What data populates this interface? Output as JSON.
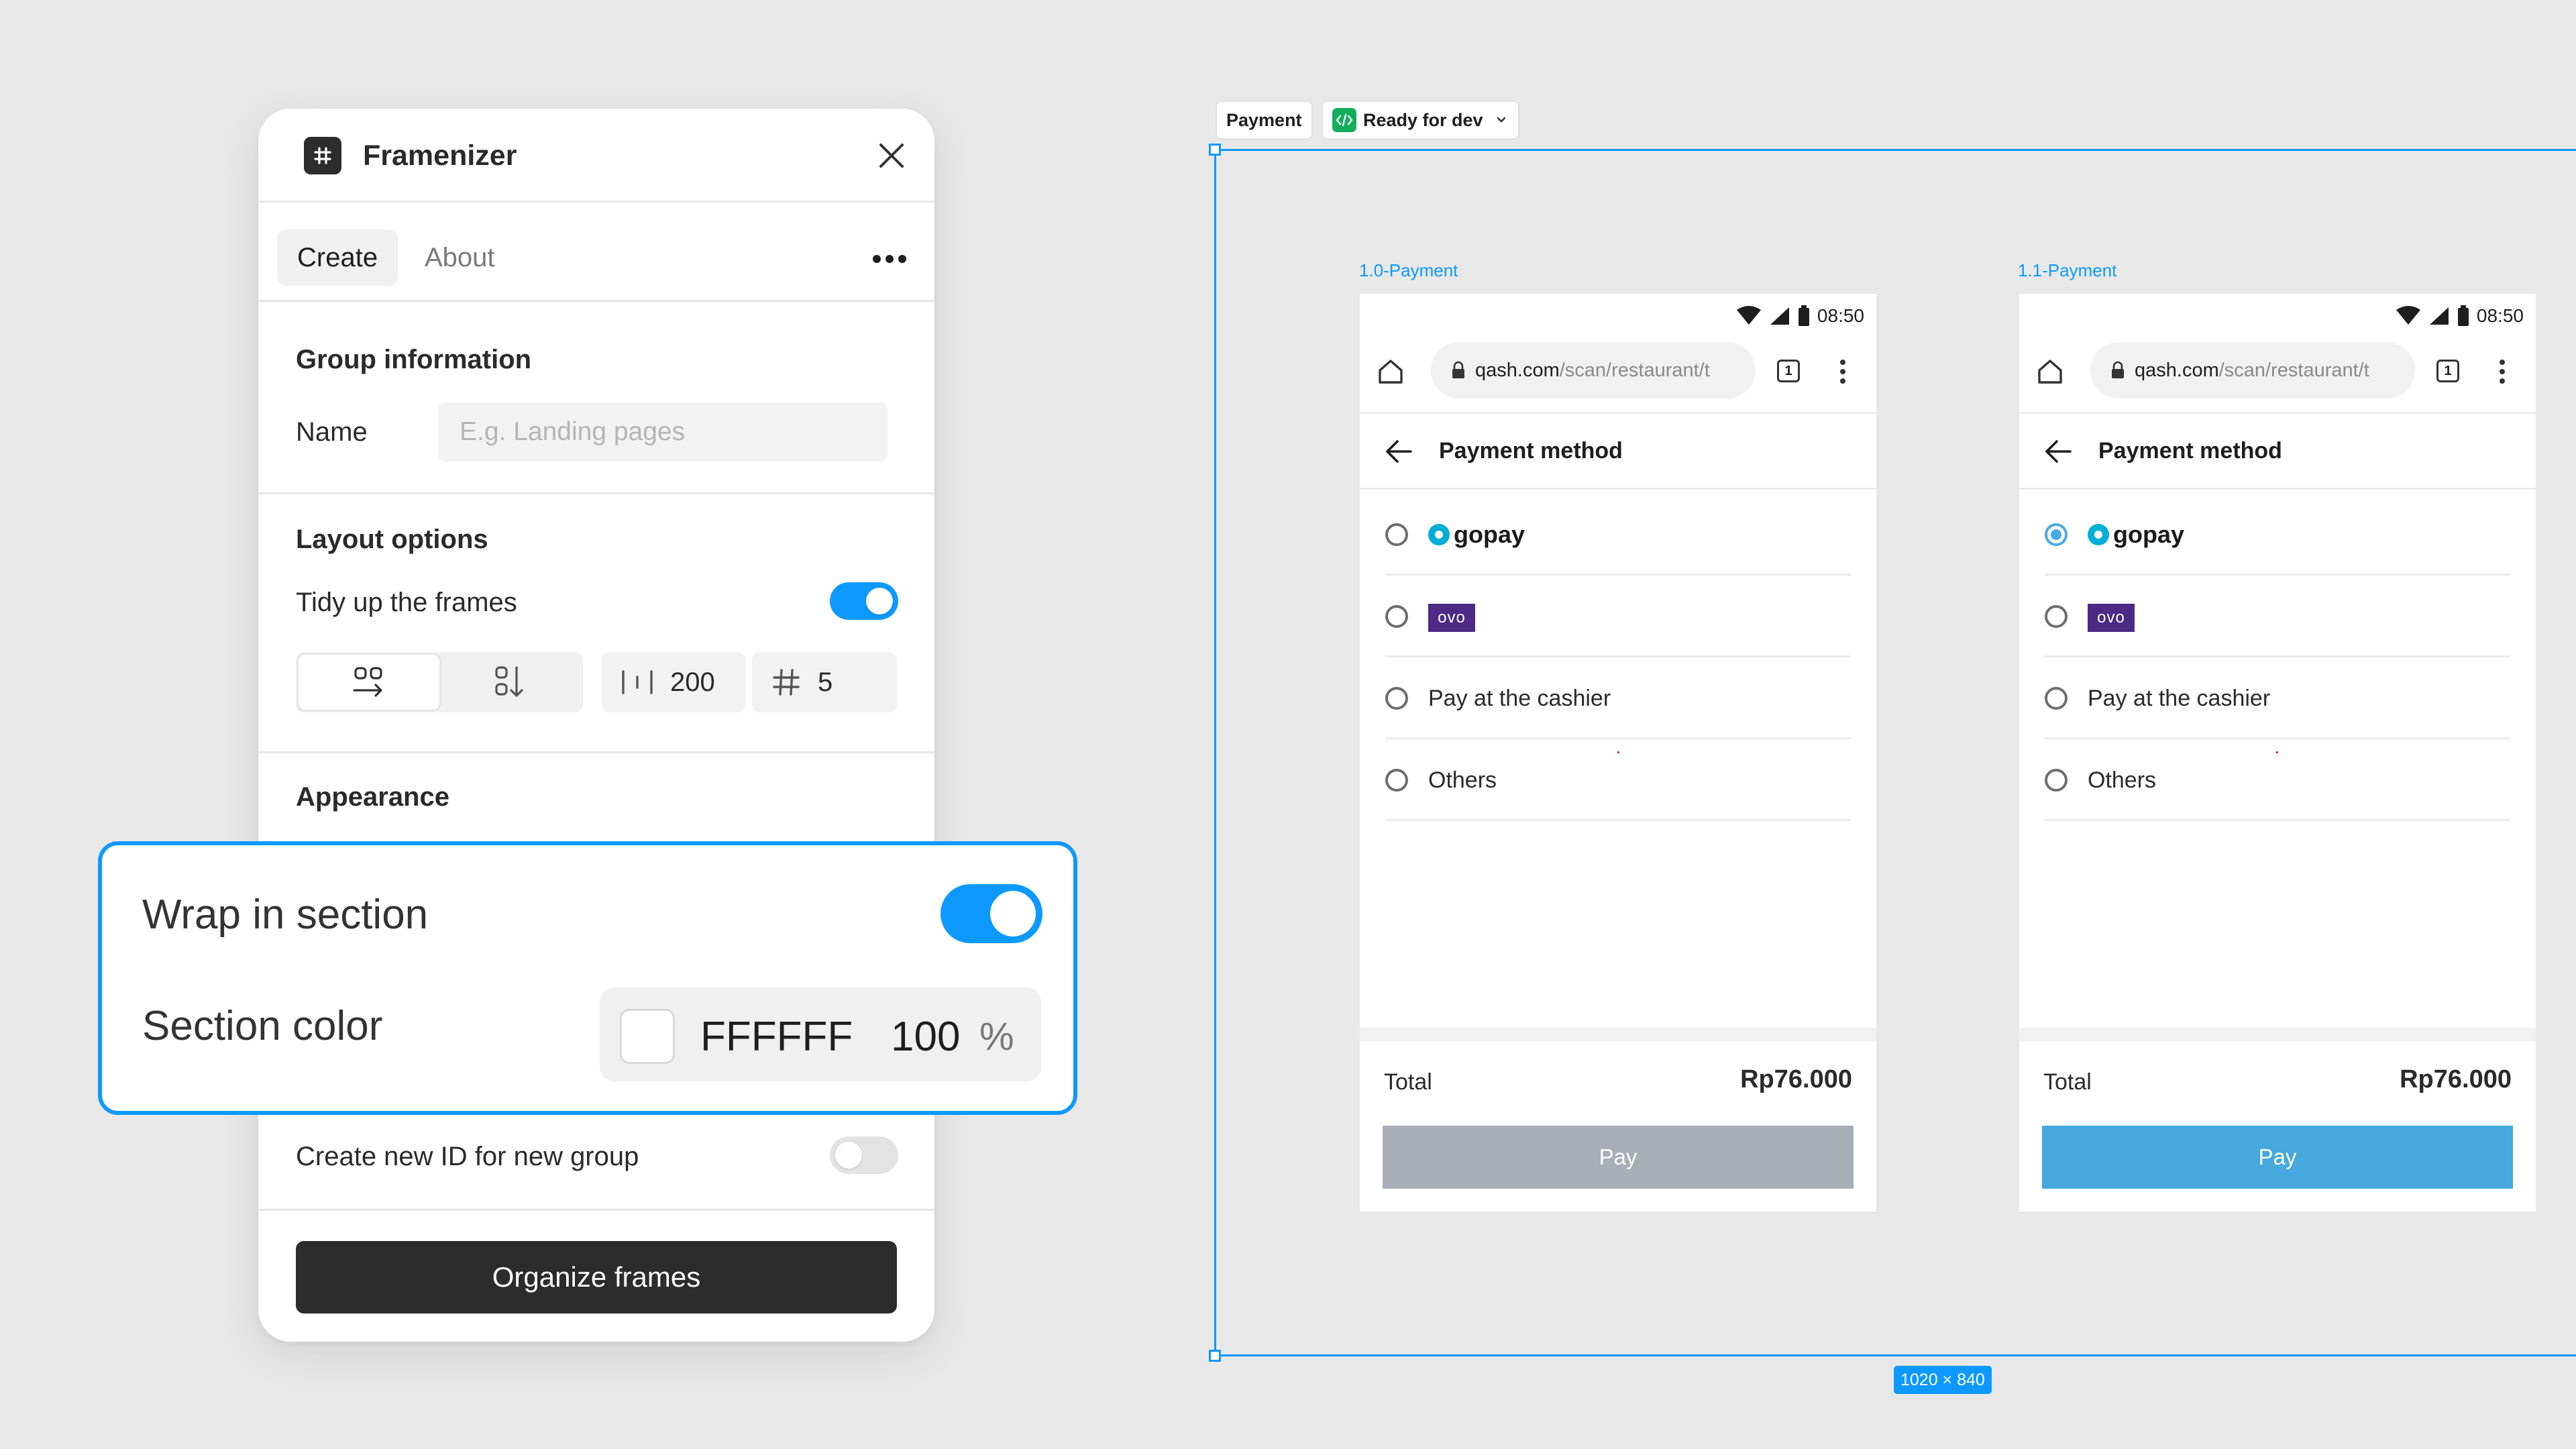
{
  "plugin": {
    "title": "Framenizer",
    "tabs": [
      {
        "label": "Create"
      },
      {
        "label": "About"
      }
    ],
    "group_information": {
      "title": "Group information",
      "name_label": "Name",
      "name_placeholder": "E.g. Landing pages",
      "name_value": ""
    },
    "layout_options": {
      "title": "Layout options",
      "tidy_label": "Tidy up the frames",
      "tidy_on": true,
      "spacing_value": "200",
      "columns_value": "5"
    },
    "appearance": {
      "title": "Appearance"
    },
    "new_id_label": "Create new ID for new group",
    "new_id_on": false,
    "organize_label": "Organize frames"
  },
  "zoom": {
    "wrap_label": "Wrap in section",
    "wrap_on": true,
    "color_label": "Section color",
    "color_hex": "FFFFFF",
    "opacity": "100",
    "opacity_unit": "%"
  },
  "canvas": {
    "section_name": "Payment",
    "status_label": "Ready for dev",
    "dimensions": "1020 × 840",
    "frames": [
      {
        "label": "1.0-Payment",
        "time": "08:50",
        "url_main": "qash.com",
        "url_rest": "/scan/restaurant/t",
        "tab_count": "1",
        "page_title": "Payment method",
        "options": {
          "gopay": "gopay",
          "ovo": "ovo",
          "cashier": "Pay at the cashier",
          "others": "Others"
        },
        "total_label": "Total",
        "total_value": "Rp76.000",
        "pay_label": "Pay"
      },
      {
        "label": "1.1-Payment",
        "time": "08:50",
        "url_main": "qash.com",
        "url_rest": "/scan/restaurant/t",
        "tab_count": "1",
        "page_title": "Payment method",
        "options": {
          "gopay": "gopay",
          "ovo": "ovo",
          "cashier": "Pay at the cashier",
          "others": "Others"
        },
        "total_label": "Total",
        "total_value": "Rp76.000",
        "pay_label": "Pay"
      }
    ]
  },
  "colors": {
    "accent": "#0d99ff",
    "pay_disabled": "#a8adb6",
    "pay_enabled": "#46a8dc"
  }
}
